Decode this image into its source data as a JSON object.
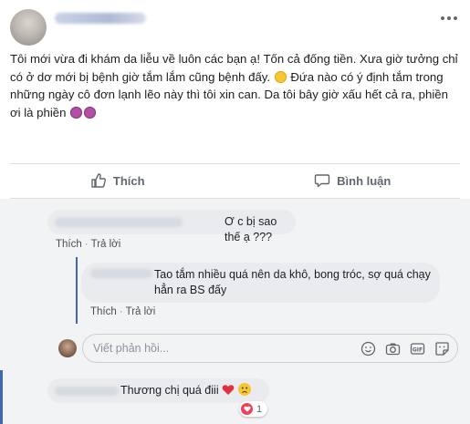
{
  "post": {
    "author": "",
    "text_part1": "Tôi mới vừa đi khám da liễu về luôn các bạn ạ! Tốn cả đống tiền. Xưa giờ tưởng chỉ có ở dơ mới bị bệnh giờ tắm lắm cũng bệnh đấy.",
    "text_part2": "Đứa nào có ý định tắm trong những ngày cô đơn lạnh lẽo này thì tôi xin can. Da tôi bây giờ xấu hết cả ra, phiền ơi là phiền",
    "icons": {
      "more": "more-options-icon",
      "smile": "smile-emoji-icon",
      "sad": "angry-purple-emoji-icon"
    }
  },
  "actions": {
    "like_label": "Thích",
    "comment_label": "Bình luận"
  },
  "comments": [
    {
      "text": "Ơ c bị sao thế ạ ???",
      "like_link": "Thích",
      "reply_link": "Trả lời",
      "replies": [
        {
          "text": "Tao tắm nhiều quá nên da khô, bong tróc, sợ quá chạy hẳn ra BS đấy",
          "like_link": "Thích",
          "reply_link": "Trả lời"
        }
      ]
    },
    {
      "text": "Thương chị quá điii",
      "reaction_count": "1"
    }
  ],
  "reply_box": {
    "placeholder": "Viết phản hồi...",
    "icons": [
      "emoji-icon",
      "camera-icon",
      "gif-icon",
      "sticker-icon"
    ]
  },
  "colors": {
    "accent": "#4267b2",
    "heart": "#f33e58",
    "text": "#1c1e21",
    "muted": "#606770"
  }
}
